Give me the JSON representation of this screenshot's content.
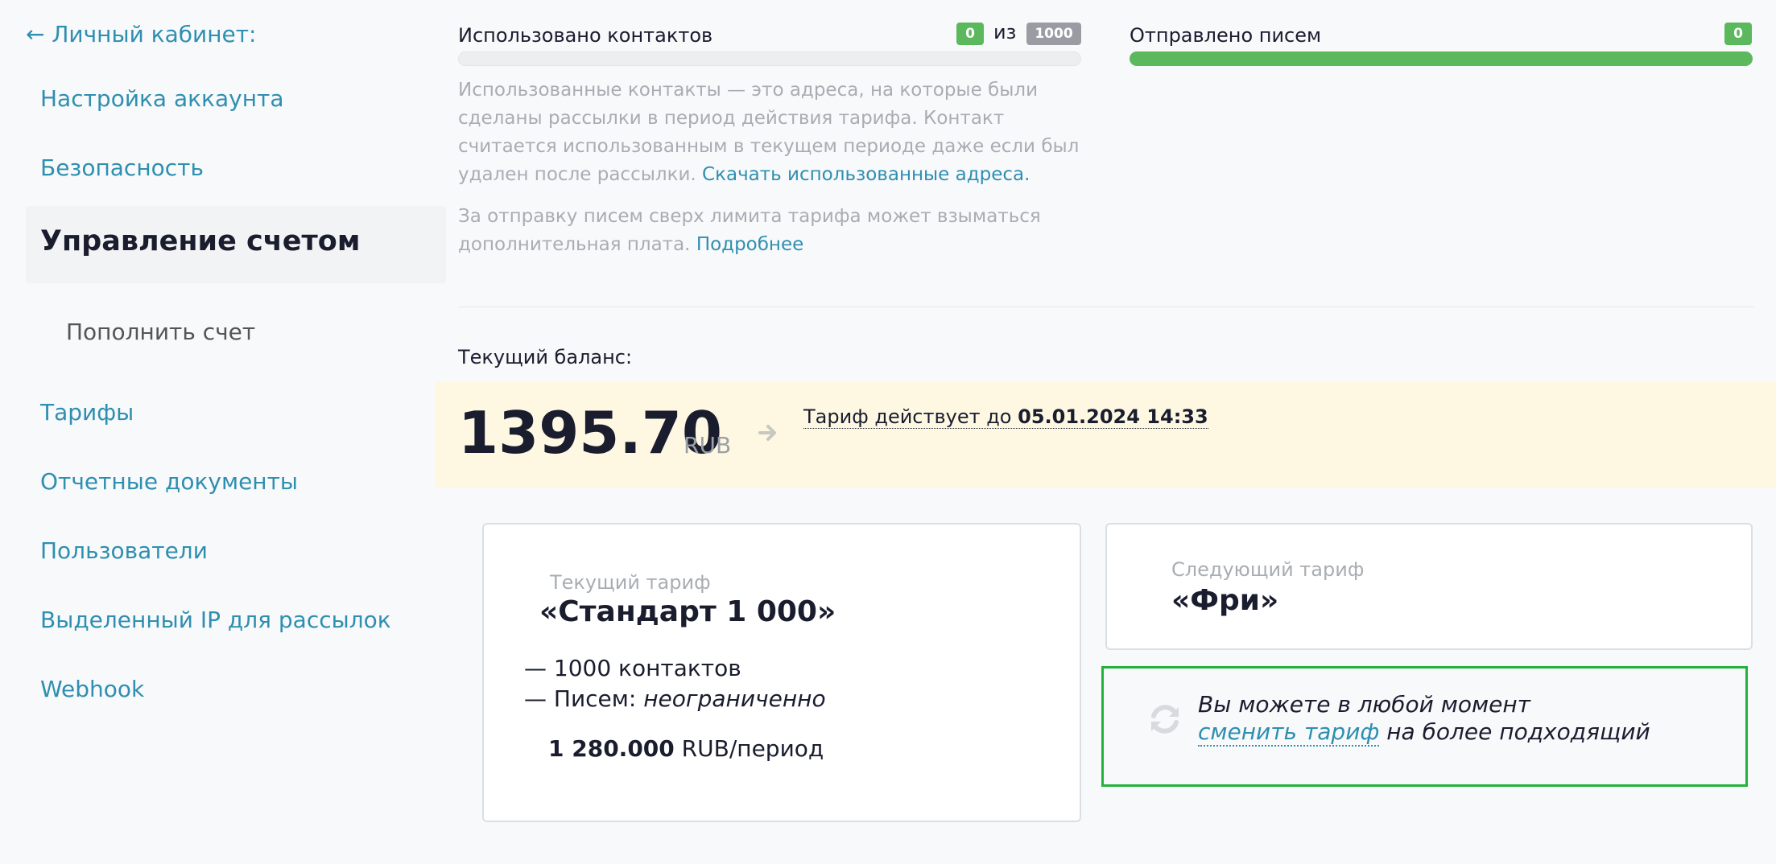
{
  "sidebar": {
    "back_label": "← Личный кабинет:",
    "items": [
      {
        "label": "Настройка аккаунта"
      },
      {
        "label": "Безопасность"
      },
      {
        "label": "Управление счетом"
      },
      {
        "label": "Пополнить счет"
      },
      {
        "label": "Тарифы"
      },
      {
        "label": "Отчетные документы"
      },
      {
        "label": "Пользователи"
      },
      {
        "label": "Выделенный IP для рассылок"
      },
      {
        "label": "Webhook"
      }
    ]
  },
  "usage": {
    "contacts_label": "Использовано контактов",
    "contacts_used": "0",
    "of_label": "из",
    "contacts_total": "1000",
    "contacts_progress": 0,
    "letters_label": "Отправлено писем",
    "letters_sent": "0",
    "letters_progress": 1
  },
  "description": {
    "text": "Использованные контакты — это адреса, на которые были сделаны рассылки в период действия тарифа. Контакт считается использованным в текущем периоде даже если был удален после рассылки.",
    "download_link": "Скачать использованные адреса.",
    "fee_text": "За отправку писем сверх лимита тарифа может взыматься дополнительная плата.",
    "more_link": "Подробнее"
  },
  "balance": {
    "label": "Текущий баланс:",
    "amount": "1395.70",
    "currency": "RUB",
    "until_text": "Тариф действует до",
    "until_date": "05.01.2024 14:33"
  },
  "current_tariff": {
    "label": "Текущий тариф",
    "name": "«Стандарт 1 000»",
    "contacts": "— 1000 контактов",
    "letters_prefix": "— Писем:",
    "letters_value": "неограниченно",
    "price": "1 280.000",
    "price_unit": "RUB/период"
  },
  "next_tariff": {
    "label": "Следующий тариф",
    "name": "«Фри»"
  },
  "change_notice": {
    "line1": "Вы можете в любой момент",
    "link": "сменить тариф",
    "line2_suffix": " на более подходящий"
  },
  "colors": {
    "accent": "#2e8fb0",
    "success": "#5cb85c",
    "highlight_bg": "#fef8e3",
    "notice_border": "#22b33a"
  }
}
